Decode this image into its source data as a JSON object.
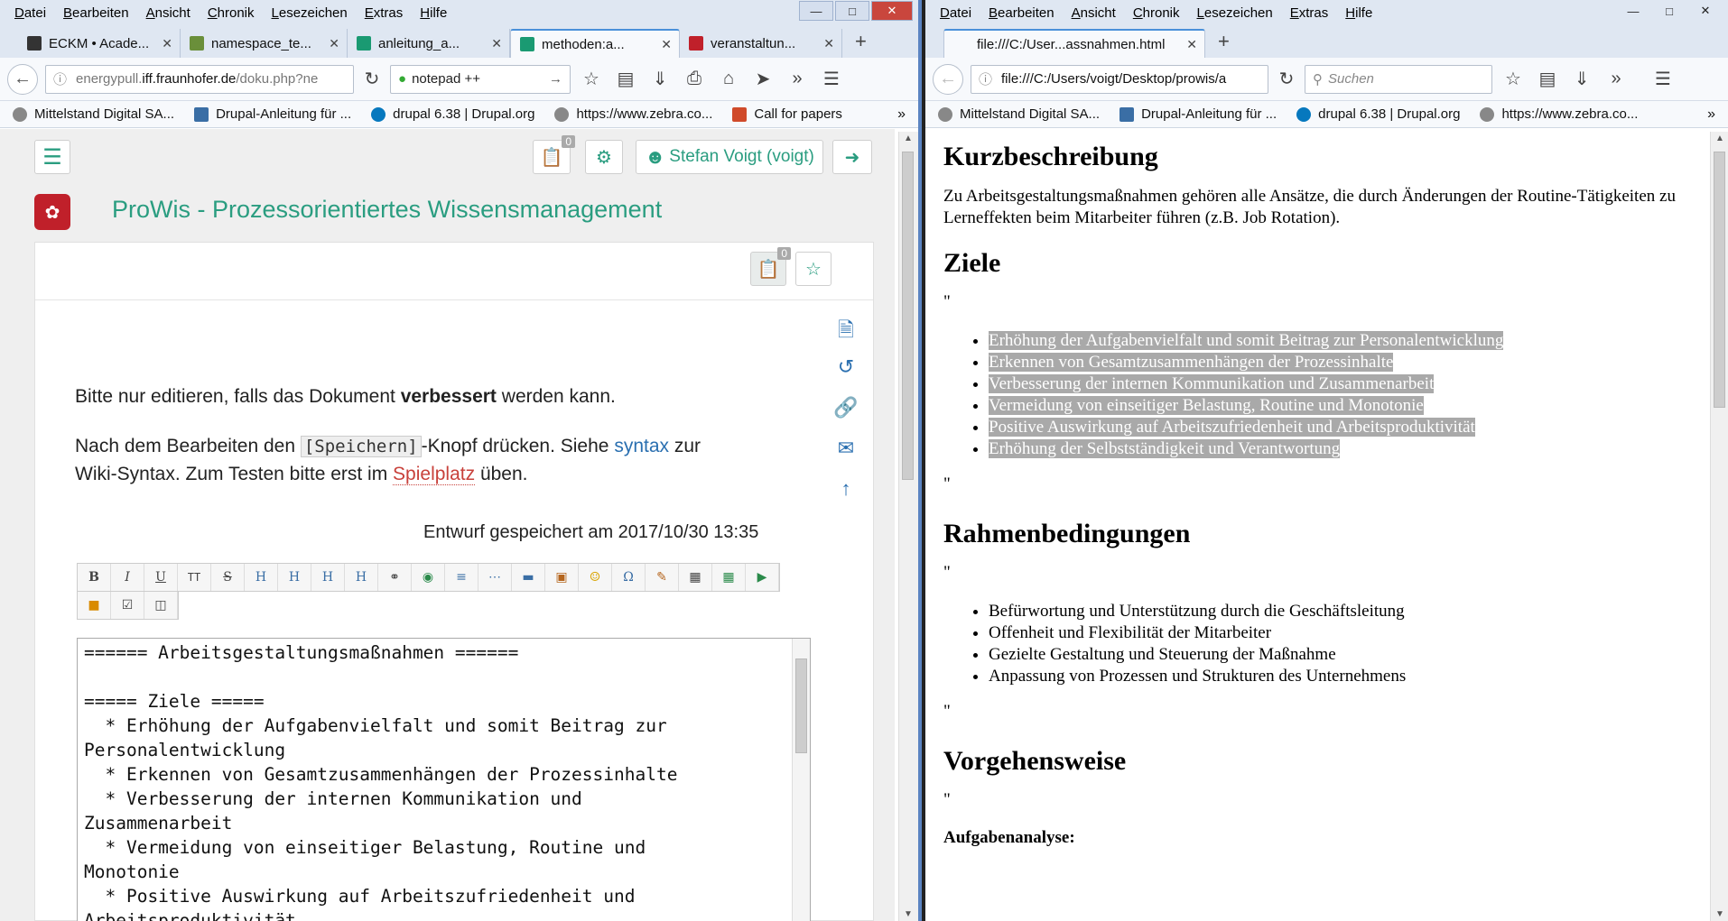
{
  "menu": [
    "Datei",
    "Bearbeiten",
    "Ansicht",
    "Chronik",
    "Lesezeichen",
    "Extras",
    "Hilfe"
  ],
  "menu_right": [
    "Datei",
    "Bearbeiten",
    "Ansicht",
    "Chronik",
    "Lesezeichen",
    "Extras",
    "Hilfe"
  ],
  "tabs_left": [
    {
      "label": "ECKM • Acade...",
      "color": "#333"
    },
    {
      "label": "namespace_te...",
      "color": "#6a8f3a"
    },
    {
      "label": "anleitung_a...",
      "color": "#1a9a72"
    },
    {
      "label": "methoden:a...",
      "color": "#1a9a72"
    },
    {
      "label": "veranstaltun...",
      "color": "#c0202a"
    }
  ],
  "tab_right": "file:///C:/User...assnahmen.html",
  "nav_left": {
    "url_gray": "energypull.",
    "url_dark": "iff.fraunhofer.de",
    "url_tail": "/doku.php?ne",
    "search": "notepad ++"
  },
  "nav_right": {
    "url": "file:///C:/Users/voigt/Desktop/prowis/a",
    "search_placeholder": "Suchen"
  },
  "bookmarks_left": [
    "Mittelstand Digital SA...",
    "Drupal-Anleitung für ...",
    "drupal 6.38 | Drupal.org",
    "https://www.zebra.co...",
    "Call for papers"
  ],
  "bookmarks_right": [
    "Mittelstand Digital SA...",
    "Drupal-Anleitung für ...",
    "drupal 6.38 | Drupal.org",
    "https://www.zebra.co..."
  ],
  "wiki": {
    "user": "Stefan Voigt (voigt)",
    "badge": "0",
    "badge2": "0",
    "title": "ProWis - Prozessorientiertes Wissensmanagement",
    "p1a": "Bitte nur editieren, falls das Dokument ",
    "p1b": "verbessert",
    "p1c": " werden kann.",
    "p2a": "Nach dem Bearbeiten den ",
    "p2code": "[Speichern]",
    "p2b": "-Knopf drücken. Siehe ",
    "p2link": "syntax",
    "p2c": " zur",
    "p3a": "Wiki-Syntax. Zum Testen bitte erst im ",
    "p3link": "Spielplatz",
    "p3b": " üben.",
    "draft": "Entwurf gespeichert am 2017/10/30 13:35",
    "editor": "====== Arbeitsgestaltungsmaßnahmen ======\n\n===== Ziele =====\n  * Erhöhung der Aufgabenvielfalt und somit Beitrag zur\nPersonalentwicklung\n  * Erkennen von Gesamtzusammenhängen der Prozessinhalte\n  * Verbesserung der internen Kommunikation und\nZusammenarbeit\n  * Vermeidung von einseitiger Belastung, Routine und\nMonotonie\n  * Positive Auswirkung auf Arbeitszufriedenheit und\nArbeitsproduktivität"
  },
  "doc": {
    "h1": "Kurzbeschreibung",
    "p1": "Zu Arbeitsgestaltungsmaßnahmen gehören alle Ansätze, die durch Änderungen der Routine-Tätigkeiten zu Lerneffekten beim Mitarbeiter führen (z.B. Job Rotation).",
    "h2": "Ziele",
    "q": "\"",
    "ziele": [
      "Erhöhung der Aufgabenvielfalt und somit Beitrag zur Personalentwicklung",
      "Erkennen von Gesamtzusammenhängen der Prozessinhalte",
      "Verbesserung der internen Kommunikation und Zusammenarbeit",
      "Vermeidung von einseitiger Belastung, Routine und Monotonie",
      "Positive Auswirkung auf Arbeitszufriedenheit und Arbeitsproduktivität",
      "Erhöhung der Selbstständigkeit und Verantwortung"
    ],
    "h3": "Rahmenbedingungen",
    "rahmen": [
      "Befürwortung und Unterstützung durch die Geschäftsleitung",
      "Offenheit und Flexibilität der Mitarbeiter",
      "Gezielte Gestaltung und Steuerung der Maßnahme",
      "Anpassung von Prozessen und Strukturen des Unternehmens"
    ],
    "h4": "Vorgehensweise",
    "h5": "Aufgabenanalyse:"
  }
}
